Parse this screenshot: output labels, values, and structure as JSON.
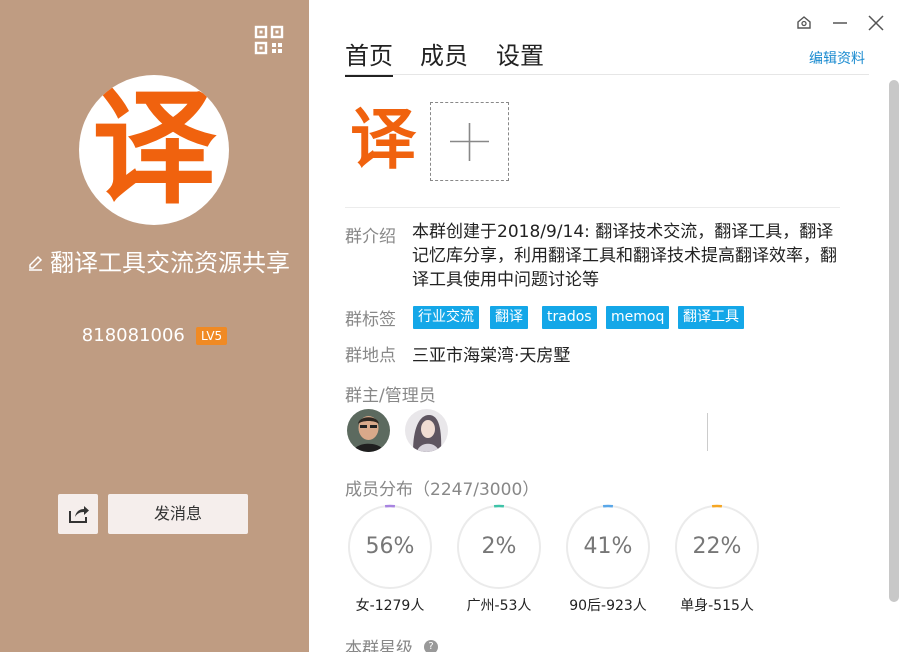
{
  "left": {
    "avatar_char": "译",
    "group_name": "翻译工具交流资源共享",
    "group_id": "818081006",
    "level": "LV5",
    "send_button": "发消息",
    "colors": {
      "panel_bg": "#bf9c82",
      "level_badge": "#f08a24",
      "avatar_char": "#f0620e"
    }
  },
  "header": {
    "tabs": [
      {
        "label": "首页",
        "active": true
      },
      {
        "label": "成员",
        "active": false
      },
      {
        "label": "设置",
        "active": false
      }
    ],
    "edit_link": "编辑资料"
  },
  "profile": {
    "photo_char": "译",
    "intro_label": "群介绍",
    "intro_text": "本群创建于2018/9/14: 翻译技术交流，翻译工具，翻译记忆库分享，利用翻译工具和翻译技术提高翻译效率，翻译工具使用中问题讨论等",
    "tags_label": "群标签",
    "tags": [
      "行业交流",
      "翻译",
      "trados",
      "memoq",
      "翻译工具"
    ],
    "location_label": "群地点",
    "location": "三亚市海棠湾·天房墅",
    "admin_label": "群主/管理员",
    "distribution_label": "成员分布（2247/3000）",
    "stats": [
      {
        "percent": "56%",
        "fraction": 0.56,
        "label": "女-1279人",
        "color": "#a884e0"
      },
      {
        "percent": "2%",
        "fraction": 0.02,
        "label": "广州-53人",
        "color": "#3fc3a8"
      },
      {
        "percent": "41%",
        "fraction": 0.41,
        "label": "90后-923人",
        "color": "#5aa7e8"
      },
      {
        "percent": "22%",
        "fraction": 0.22,
        "label": "单身-515人",
        "color": "#f5a623"
      }
    ],
    "star_label": "本群星级",
    "help_glyph": "?"
  },
  "icons": {
    "qr": "qr-code-icon",
    "edit": "pencil-icon",
    "share": "share-icon",
    "skin": "skin-icon",
    "minimize": "minimize-icon",
    "close": "close-icon",
    "add": "plus-icon"
  }
}
